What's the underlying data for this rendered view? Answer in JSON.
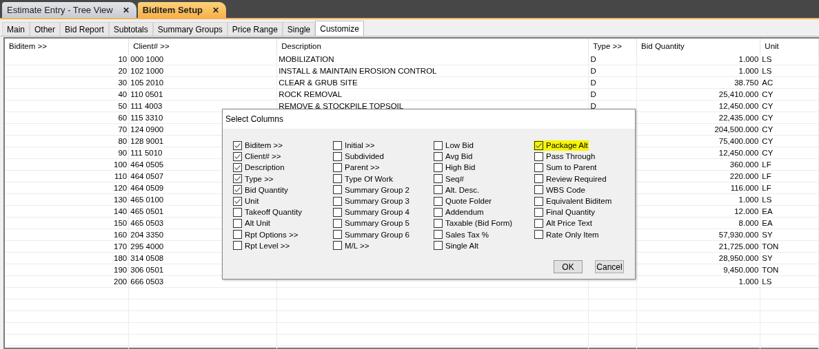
{
  "doc_tabs": [
    {
      "label": "Estimate Entry - Tree View",
      "close": "✕",
      "selected": false
    },
    {
      "label": "Biditem Setup",
      "close": "✕",
      "selected": true
    }
  ],
  "sub_tabs": [
    {
      "label": "Main",
      "selected": false
    },
    {
      "label": "Other",
      "selected": false
    },
    {
      "label": "Bid Report",
      "selected": false
    },
    {
      "label": "Subtotals",
      "selected": false
    },
    {
      "label": "Summary Groups",
      "selected": false
    },
    {
      "label": "Price Range",
      "selected": false
    },
    {
      "label": "Single",
      "selected": false
    },
    {
      "label": "Customize",
      "selected": true
    }
  ],
  "table": {
    "columns": [
      "Biditem >>",
      "Client# >>",
      "Description",
      "Type >>",
      "Bid Quantity",
      "Unit"
    ],
    "rows": [
      {
        "biditem": "10",
        "client": "000 1000",
        "description": "MOBILIZATION",
        "type": "D",
        "quantity": "1.000",
        "unit": "LS"
      },
      {
        "biditem": "20",
        "client": "102 1000",
        "description": "INSTALL & MAINTAIN EROSION CONTROL",
        "type": "D",
        "quantity": "1.000",
        "unit": "LS"
      },
      {
        "biditem": "30",
        "client": "105 2010",
        "description": "CLEAR & GRUB SITE",
        "type": "D",
        "quantity": "38.750",
        "unit": "AC"
      },
      {
        "biditem": "40",
        "client": "110 0501",
        "description": "ROCK REMOVAL",
        "type": "D",
        "quantity": "25,410.000",
        "unit": "CY"
      },
      {
        "biditem": "50",
        "client": "111 4003",
        "description": "REMOVE & STOCKPILE TOPSOIL",
        "type": "D",
        "quantity": "12,450.000",
        "unit": "CY"
      },
      {
        "biditem": "60",
        "client": "115 3310",
        "quantity": "22,435.000",
        "unit": "CY"
      },
      {
        "biditem": "70",
        "client": "124 0900",
        "quantity": "204,500.000",
        "unit": "CY"
      },
      {
        "biditem": "80",
        "client": "128 9001",
        "quantity": "75,400.000",
        "unit": "CY"
      },
      {
        "biditem": "90",
        "client": "111 5010",
        "quantity": "12,450.000",
        "unit": "CY"
      },
      {
        "biditem": "100",
        "client": "464 0505",
        "quantity": "360.000",
        "unit": "LF"
      },
      {
        "biditem": "110",
        "client": "464 0507",
        "quantity": "220.000",
        "unit": "LF"
      },
      {
        "biditem": "120",
        "client": "464 0509",
        "quantity": "116.000",
        "unit": "LF"
      },
      {
        "biditem": "130",
        "client": "465 0100",
        "quantity": "1.000",
        "unit": "LS"
      },
      {
        "biditem": "140",
        "client": "465 0501",
        "quantity": "12.000",
        "unit": "EA"
      },
      {
        "biditem": "150",
        "client": "465 0503",
        "quantity": "8.000",
        "unit": "EA"
      },
      {
        "biditem": "160",
        "client": "204 3350",
        "quantity": "57,930.000",
        "unit": "SY"
      },
      {
        "biditem": "170",
        "client": "295 4000",
        "quantity": "21,725.000",
        "unit": "TON"
      },
      {
        "biditem": "180",
        "client": "314 0508",
        "quantity": "28,950.000",
        "unit": "SY"
      },
      {
        "biditem": "190",
        "client": "306 0501",
        "quantity": "9,450.000",
        "unit": "TON"
      },
      {
        "biditem": "200",
        "client": "666 0503",
        "quantity": "1.000",
        "unit": "LS"
      }
    ]
  },
  "dialog": {
    "title": "Select Columns",
    "groups": [
      [
        {
          "label": "Biditem >>",
          "checked": true,
          "highlighted": false
        },
        {
          "label": "Client# >>",
          "checked": true,
          "highlighted": false
        },
        {
          "label": "Description",
          "checked": true,
          "highlighted": false
        },
        {
          "label": "Type >>",
          "checked": true,
          "highlighted": false
        },
        {
          "label": "Bid Quantity",
          "checked": true,
          "highlighted": false
        },
        {
          "label": "Unit",
          "checked": true,
          "highlighted": false
        },
        {
          "label": "Takeoff Quantity",
          "checked": false,
          "highlighted": false
        },
        {
          "label": "Alt Unit",
          "checked": false,
          "highlighted": false
        },
        {
          "label": "Rpt Options >>",
          "checked": false,
          "highlighted": false
        },
        {
          "label": "Rpt Level >>",
          "checked": false,
          "highlighted": false
        }
      ],
      [
        {
          "label": "Initial >>",
          "checked": false,
          "highlighted": false
        },
        {
          "label": "Subdivided",
          "checked": false,
          "highlighted": false
        },
        {
          "label": "Parent >>",
          "checked": false,
          "highlighted": false
        },
        {
          "label": "Type Of Work",
          "checked": false,
          "highlighted": false
        },
        {
          "label": "Summary Group 2",
          "checked": false,
          "highlighted": false
        },
        {
          "label": "Summary Group 3",
          "checked": false,
          "highlighted": false
        },
        {
          "label": "Summary Group 4",
          "checked": false,
          "highlighted": false
        },
        {
          "label": "Summary Group 5",
          "checked": false,
          "highlighted": false
        },
        {
          "label": "Summary Group 6",
          "checked": false,
          "highlighted": false
        },
        {
          "label": "M/L >>",
          "checked": false,
          "highlighted": false
        }
      ],
      [
        {
          "label": "Low Bid",
          "checked": false,
          "highlighted": false
        },
        {
          "label": "Avg Bid",
          "checked": false,
          "highlighted": false
        },
        {
          "label": "High Bid",
          "checked": false,
          "highlighted": false
        },
        {
          "label": "Seq#",
          "checked": false,
          "highlighted": false
        },
        {
          "label": "Alt. Desc.",
          "checked": false,
          "highlighted": false
        },
        {
          "label": "Quote Folder",
          "checked": false,
          "highlighted": false
        },
        {
          "label": "Addendum",
          "checked": false,
          "highlighted": false
        },
        {
          "label": "Taxable (Bid Form)",
          "checked": false,
          "highlighted": false
        },
        {
          "label": "Sales Tax %",
          "checked": false,
          "highlighted": false
        },
        {
          "label": "Single Alt",
          "checked": false,
          "highlighted": false
        }
      ],
      [
        {
          "label": "Package Alt",
          "checked": true,
          "highlighted": true
        },
        {
          "label": "Pass Through",
          "checked": false,
          "highlighted": false
        },
        {
          "label": "Sum to Parent",
          "checked": false,
          "highlighted": false
        },
        {
          "label": "Review Required",
          "checked": false,
          "highlighted": false
        },
        {
          "label": "WBS Code",
          "checked": false,
          "highlighted": false
        },
        {
          "label": "Equivalent Biditem",
          "checked": false,
          "highlighted": false
        },
        {
          "label": "Final Quantity",
          "checked": false,
          "highlighted": false
        },
        {
          "label": "Alt Price Text",
          "checked": false,
          "highlighted": false
        },
        {
          "label": "Rate Only Item",
          "checked": false,
          "highlighted": false
        }
      ]
    ],
    "buttons": [
      "OK",
      "Cancel"
    ]
  }
}
